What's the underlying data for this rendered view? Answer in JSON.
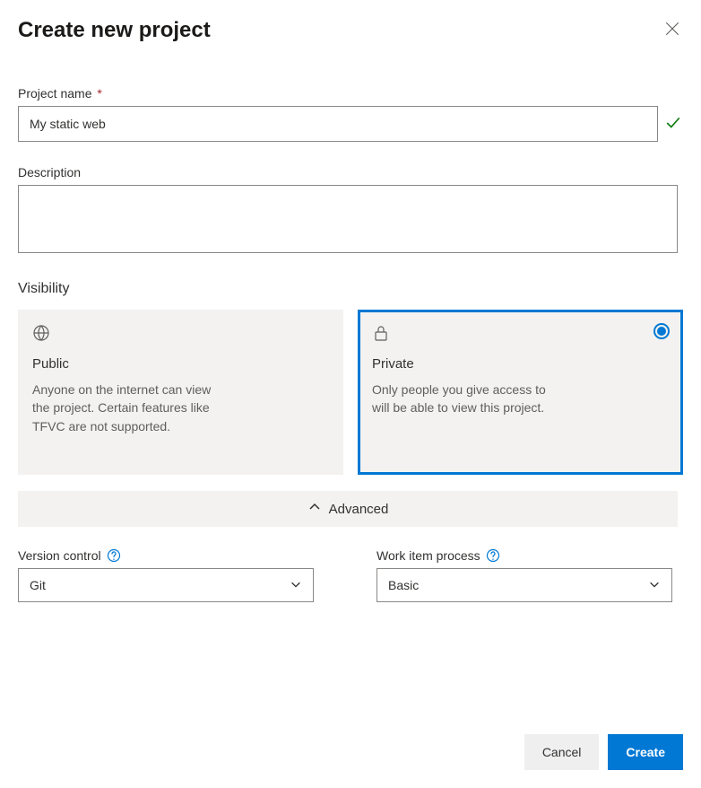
{
  "dialog": {
    "title": "Create new project"
  },
  "fields": {
    "project_name": {
      "label": "Project name",
      "required_marker": "*",
      "value": "My static web"
    },
    "description": {
      "label": "Description",
      "value": ""
    }
  },
  "visibility": {
    "label": "Visibility",
    "options": {
      "public": {
        "title": "Public",
        "description": "Anyone on the internet can view the project. Certain features like TFVC are not supported.",
        "selected": false
      },
      "private": {
        "title": "Private",
        "description": "Only people you give access to will be able to view this project.",
        "selected": true
      }
    }
  },
  "advanced": {
    "toggle_label": "Advanced",
    "expanded": true,
    "version_control": {
      "label": "Version control",
      "value": "Git"
    },
    "work_item_process": {
      "label": "Work item process",
      "value": "Basic"
    }
  },
  "buttons": {
    "cancel": "Cancel",
    "create": "Create"
  }
}
